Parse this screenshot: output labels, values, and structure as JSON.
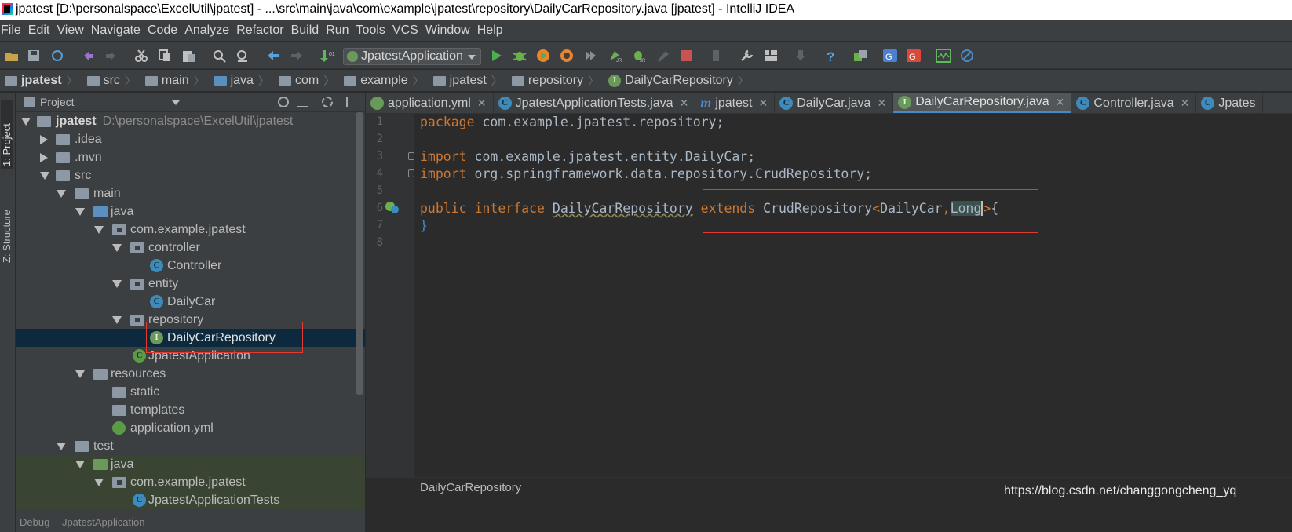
{
  "window": {
    "title": "jpatest [D:\\personalspace\\ExcelUtil\\jpatest] - ...\\src\\main\\java\\com\\example\\jpatest\\repository\\DailyCarRepository.java [jpatest] - IntelliJ IDEA"
  },
  "menu": [
    {
      "label": "File",
      "u": "F",
      "rest": "ile"
    },
    {
      "label": "Edit",
      "u": "E",
      "rest": "dit"
    },
    {
      "label": "View",
      "u": "V",
      "rest": "iew"
    },
    {
      "label": "Navigate",
      "u": "N",
      "rest": "avigate"
    },
    {
      "label": "Code",
      "u": "C",
      "rest": "ode"
    },
    {
      "label": "Analyze",
      "u": "",
      "rest": "Analyze"
    },
    {
      "label": "Refactor",
      "u": "R",
      "rest": "efactor"
    },
    {
      "label": "Build",
      "u": "B",
      "rest": "uild"
    },
    {
      "label": "Run",
      "u": "R",
      "rest": "un"
    },
    {
      "label": "Tools",
      "u": "T",
      "rest": "ools"
    },
    {
      "label": "VCS",
      "u": "",
      "rest": "VCS"
    },
    {
      "label": "Window",
      "u": "W",
      "rest": "indow"
    },
    {
      "label": "Help",
      "u": "H",
      "rest": "elp"
    }
  ],
  "toolbar": {
    "run_config": "JpatestApplication"
  },
  "breadcrumbs": [
    "jpatest",
    "src",
    "main",
    "java",
    "com",
    "example",
    "jpatest",
    "repository",
    "DailyCarRepository"
  ],
  "side_tabs": {
    "project": "1: Project",
    "structure": "Z: Structure"
  },
  "project_panel": {
    "title": "Project"
  },
  "tree": {
    "root": {
      "label": "jpatest",
      "path": "D:\\personalspace\\ExcelUtil\\jpatest"
    },
    "idea": ".idea",
    "mvn": ".mvn",
    "src": "src",
    "main": "main",
    "java": "java",
    "pkg": "com.example.jpatest",
    "controller": "controller",
    "controller_cls": "Controller",
    "entity": "entity",
    "entity_cls": "DailyCar",
    "repository": "repository",
    "repository_cls": "DailyCarRepository",
    "app_cls": "JpatestApplication",
    "resources": "resources",
    "static": "static",
    "templates": "templates",
    "app_yml": "application.yml",
    "test": "test",
    "test_java": "java",
    "test_pkg": "com.example.jpatest",
    "test_cls": "JpatestApplicationTests"
  },
  "debug_strip": {
    "label": "Debug",
    "config": "JpatestApplication"
  },
  "tabs": [
    {
      "label": "application.yml",
      "icon": "y",
      "active": false
    },
    {
      "label": "JpatestApplicationTests.java",
      "icon": "c",
      "active": false
    },
    {
      "label": "jpatest",
      "icon": "m",
      "active": false
    },
    {
      "label": "DailyCar.java",
      "icon": "c",
      "active": false
    },
    {
      "label": "DailyCarRepository.java",
      "icon": "i",
      "active": true
    },
    {
      "label": "Controller.java",
      "icon": "c",
      "active": false
    },
    {
      "label": "Jpates",
      "icon": "c",
      "active": false
    }
  ],
  "code": {
    "l1_kw": "package",
    "l1_rest": " com.example.jpatest.repository;",
    "l3_kw": "import",
    "l3_rest": " com.example.jpatest.entity.DailyCar;",
    "l4_kw": "import",
    "l4_rest": " org.springframework.data.repository.CrudRepository;",
    "l6_kw1": "public",
    "l6_kw2": "interface",
    "l6_name": "DailyCarRepository",
    "l6_kw3": "extends",
    "l6_type": "CrudRepository",
    "l6_lt": "<",
    "l6_arg1": "DailyCar",
    "l6_comma": ",",
    "l6_arg2": "Long",
    "l6_gt": ">",
    "l6_brace": "{",
    "l7": "}"
  },
  "line_numbers": [
    "1",
    "2",
    "3",
    "4",
    "5",
    "6",
    "7",
    "8"
  ],
  "editor_crumb": "DailyCarRepository",
  "watermark": "https://blog.csdn.net/changgongcheng_yq",
  "colors": {
    "keyword": "#cc7832",
    "text": "#a9b7c6",
    "selection": "#0d293e",
    "highlight_box": "#e53935",
    "accent": "#4a88c7"
  }
}
